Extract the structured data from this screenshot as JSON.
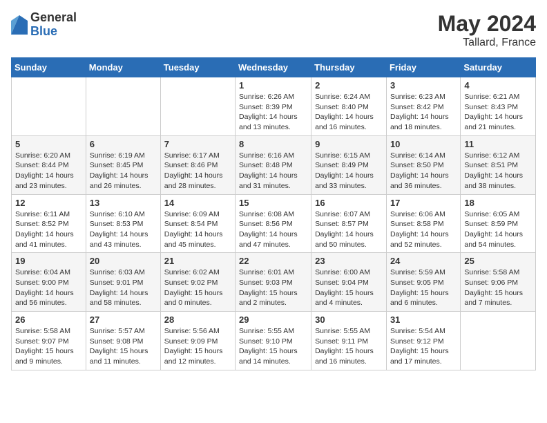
{
  "header": {
    "logo_general": "General",
    "logo_blue": "Blue",
    "month_title": "May 2024",
    "location": "Tallard, France"
  },
  "weekdays": [
    "Sunday",
    "Monday",
    "Tuesday",
    "Wednesday",
    "Thursday",
    "Friday",
    "Saturday"
  ],
  "weeks": [
    [
      {
        "day": "",
        "info": ""
      },
      {
        "day": "",
        "info": ""
      },
      {
        "day": "",
        "info": ""
      },
      {
        "day": "1",
        "info": "Sunrise: 6:26 AM\nSunset: 8:39 PM\nDaylight: 14 hours\nand 13 minutes."
      },
      {
        "day": "2",
        "info": "Sunrise: 6:24 AM\nSunset: 8:40 PM\nDaylight: 14 hours\nand 16 minutes."
      },
      {
        "day": "3",
        "info": "Sunrise: 6:23 AM\nSunset: 8:42 PM\nDaylight: 14 hours\nand 18 minutes."
      },
      {
        "day": "4",
        "info": "Sunrise: 6:21 AM\nSunset: 8:43 PM\nDaylight: 14 hours\nand 21 minutes."
      }
    ],
    [
      {
        "day": "5",
        "info": "Sunrise: 6:20 AM\nSunset: 8:44 PM\nDaylight: 14 hours\nand 23 minutes."
      },
      {
        "day": "6",
        "info": "Sunrise: 6:19 AM\nSunset: 8:45 PM\nDaylight: 14 hours\nand 26 minutes."
      },
      {
        "day": "7",
        "info": "Sunrise: 6:17 AM\nSunset: 8:46 PM\nDaylight: 14 hours\nand 28 minutes."
      },
      {
        "day": "8",
        "info": "Sunrise: 6:16 AM\nSunset: 8:48 PM\nDaylight: 14 hours\nand 31 minutes."
      },
      {
        "day": "9",
        "info": "Sunrise: 6:15 AM\nSunset: 8:49 PM\nDaylight: 14 hours\nand 33 minutes."
      },
      {
        "day": "10",
        "info": "Sunrise: 6:14 AM\nSunset: 8:50 PM\nDaylight: 14 hours\nand 36 minutes."
      },
      {
        "day": "11",
        "info": "Sunrise: 6:12 AM\nSunset: 8:51 PM\nDaylight: 14 hours\nand 38 minutes."
      }
    ],
    [
      {
        "day": "12",
        "info": "Sunrise: 6:11 AM\nSunset: 8:52 PM\nDaylight: 14 hours\nand 41 minutes."
      },
      {
        "day": "13",
        "info": "Sunrise: 6:10 AM\nSunset: 8:53 PM\nDaylight: 14 hours\nand 43 minutes."
      },
      {
        "day": "14",
        "info": "Sunrise: 6:09 AM\nSunset: 8:54 PM\nDaylight: 14 hours\nand 45 minutes."
      },
      {
        "day": "15",
        "info": "Sunrise: 6:08 AM\nSunset: 8:56 PM\nDaylight: 14 hours\nand 47 minutes."
      },
      {
        "day": "16",
        "info": "Sunrise: 6:07 AM\nSunset: 8:57 PM\nDaylight: 14 hours\nand 50 minutes."
      },
      {
        "day": "17",
        "info": "Sunrise: 6:06 AM\nSunset: 8:58 PM\nDaylight: 14 hours\nand 52 minutes."
      },
      {
        "day": "18",
        "info": "Sunrise: 6:05 AM\nSunset: 8:59 PM\nDaylight: 14 hours\nand 54 minutes."
      }
    ],
    [
      {
        "day": "19",
        "info": "Sunrise: 6:04 AM\nSunset: 9:00 PM\nDaylight: 14 hours\nand 56 minutes."
      },
      {
        "day": "20",
        "info": "Sunrise: 6:03 AM\nSunset: 9:01 PM\nDaylight: 14 hours\nand 58 minutes."
      },
      {
        "day": "21",
        "info": "Sunrise: 6:02 AM\nSunset: 9:02 PM\nDaylight: 15 hours\nand 0 minutes."
      },
      {
        "day": "22",
        "info": "Sunrise: 6:01 AM\nSunset: 9:03 PM\nDaylight: 15 hours\nand 2 minutes."
      },
      {
        "day": "23",
        "info": "Sunrise: 6:00 AM\nSunset: 9:04 PM\nDaylight: 15 hours\nand 4 minutes."
      },
      {
        "day": "24",
        "info": "Sunrise: 5:59 AM\nSunset: 9:05 PM\nDaylight: 15 hours\nand 6 minutes."
      },
      {
        "day": "25",
        "info": "Sunrise: 5:58 AM\nSunset: 9:06 PM\nDaylight: 15 hours\nand 7 minutes."
      }
    ],
    [
      {
        "day": "26",
        "info": "Sunrise: 5:58 AM\nSunset: 9:07 PM\nDaylight: 15 hours\nand 9 minutes."
      },
      {
        "day": "27",
        "info": "Sunrise: 5:57 AM\nSunset: 9:08 PM\nDaylight: 15 hours\nand 11 minutes."
      },
      {
        "day": "28",
        "info": "Sunrise: 5:56 AM\nSunset: 9:09 PM\nDaylight: 15 hours\nand 12 minutes."
      },
      {
        "day": "29",
        "info": "Sunrise: 5:55 AM\nSunset: 9:10 PM\nDaylight: 15 hours\nand 14 minutes."
      },
      {
        "day": "30",
        "info": "Sunrise: 5:55 AM\nSunset: 9:11 PM\nDaylight: 15 hours\nand 16 minutes."
      },
      {
        "day": "31",
        "info": "Sunrise: 5:54 AM\nSunset: 9:12 PM\nDaylight: 15 hours\nand 17 minutes."
      },
      {
        "day": "",
        "info": ""
      }
    ]
  ]
}
